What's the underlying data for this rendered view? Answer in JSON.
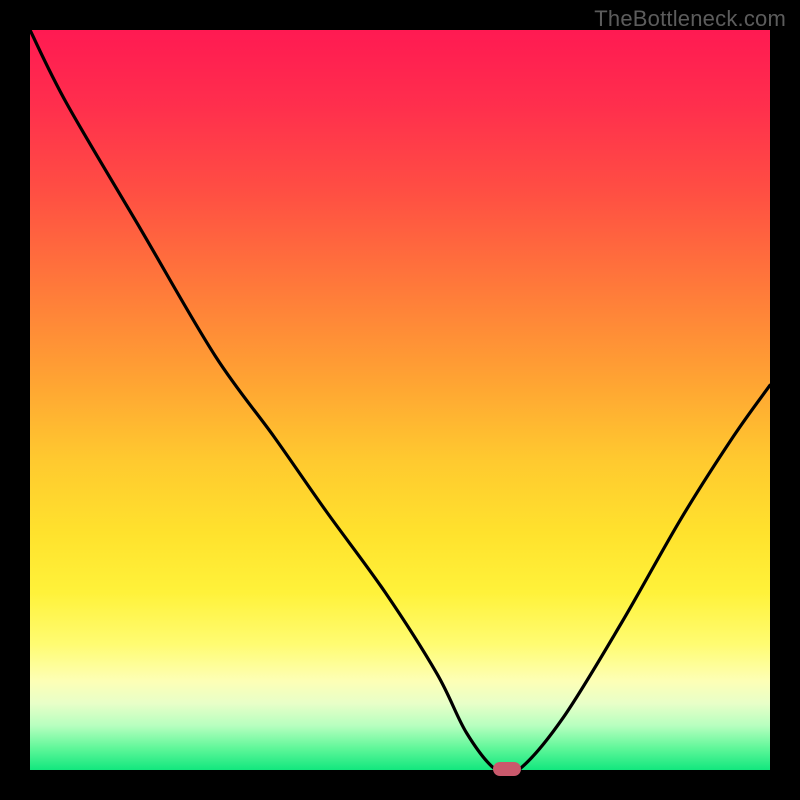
{
  "watermark": "TheBottleneck.com",
  "colors": {
    "background": "#000000",
    "curve": "#000000",
    "marker": "#c9596c",
    "gradient_top": "#ff1a52",
    "gradient_bottom": "#12e77e"
  },
  "chart_data": {
    "type": "line",
    "x": [
      0.0,
      0.05,
      0.15,
      0.25,
      0.33,
      0.4,
      0.48,
      0.55,
      0.59,
      0.63,
      0.66,
      0.72,
      0.8,
      0.88,
      0.95,
      1.0
    ],
    "values": [
      100,
      90,
      73,
      56,
      45,
      35,
      24,
      13,
      5,
      0,
      0,
      7,
      20,
      34,
      45,
      52
    ],
    "title": "",
    "xlabel": "",
    "ylabel": "",
    "ylim": [
      0,
      100
    ],
    "xlim": [
      0,
      1
    ],
    "marker_x": 0.645,
    "marker_y": 0,
    "annotations": []
  }
}
